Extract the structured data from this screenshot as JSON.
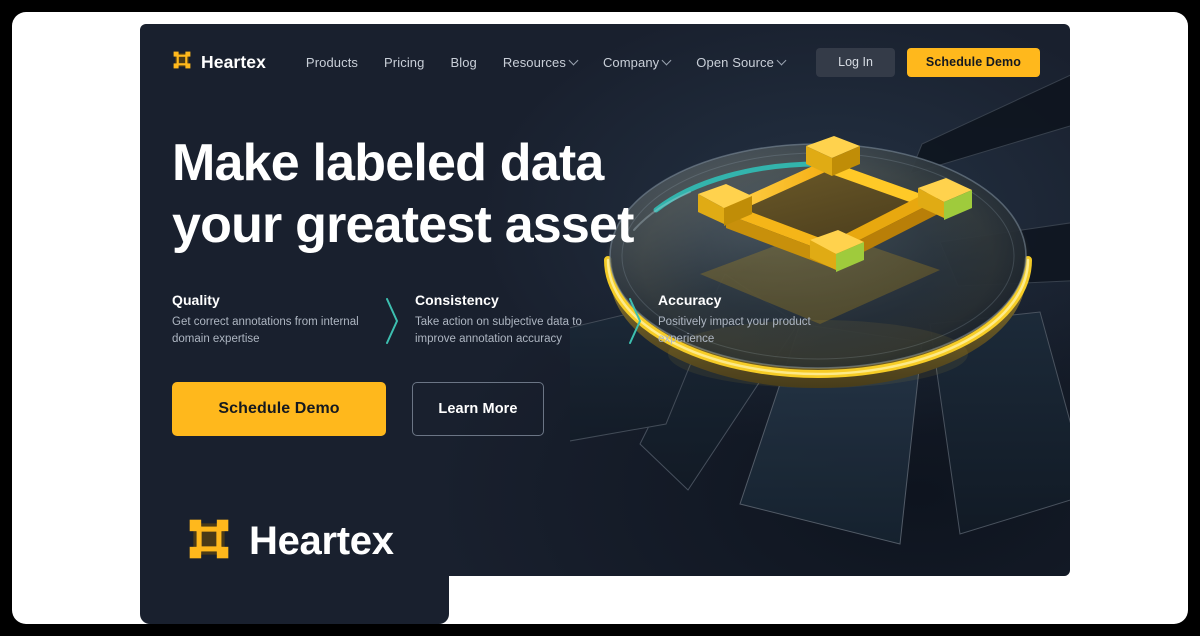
{
  "brand": {
    "name": "Heartex",
    "logo_icon": "bounding-box-logo-icon"
  },
  "nav": {
    "links": [
      {
        "label": "Products",
        "has_caret": false
      },
      {
        "label": "Pricing",
        "has_caret": false
      },
      {
        "label": "Blog",
        "has_caret": false
      },
      {
        "label": "Resources",
        "has_caret": true
      },
      {
        "label": "Company",
        "has_caret": true
      },
      {
        "label": "Open Source",
        "has_caret": true
      }
    ],
    "login_label": "Log In",
    "demo_label": "Schedule Demo"
  },
  "hero": {
    "headline_line1": "Make labeled data",
    "headline_line2": "your greatest asset",
    "features": [
      {
        "title": "Quality",
        "desc": "Get correct annotations from internal domain expertise"
      },
      {
        "title": "Consistency",
        "desc": "Take action on subjective data to improve annotation accuracy"
      },
      {
        "title": "Accuracy",
        "desc": "Positively impact your product experience"
      }
    ],
    "cta_primary": "Schedule Demo",
    "cta_secondary": "Learn More",
    "artwork_icon": "glass-disc-bounding-box-illustration"
  },
  "logo_panel": {
    "name": "Heartex",
    "logo_icon": "bounding-box-logo-icon"
  },
  "colors": {
    "accent_yellow": "#ffb81c",
    "panel_dark": "#19202e",
    "teal": "#3dbfb0",
    "page_white": "#ffffff",
    "backdrop_black": "#000000",
    "text_muted": "#aeb6c2"
  }
}
